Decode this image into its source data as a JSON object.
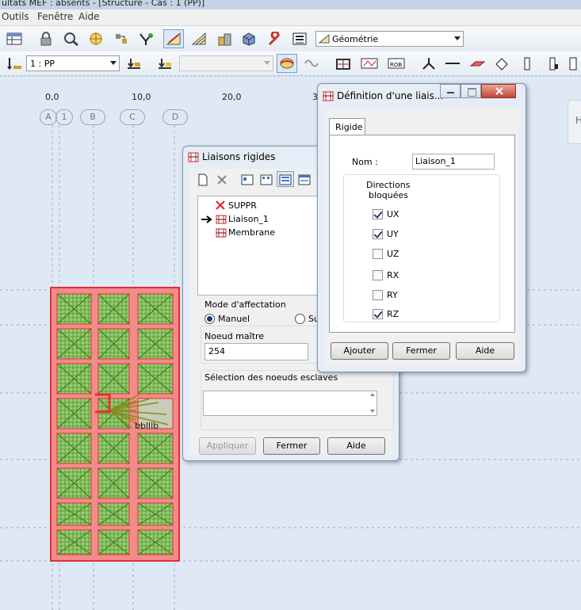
{
  "app": {
    "title_fragment": "ultats MEF : absents - [Structure - Cas : 1 (PP)]"
  },
  "menu": [
    "Outils",
    "Fenêtre",
    "Aide"
  ],
  "toolbar": {
    "view_selector": "Géométrie",
    "load_case_selector": "1 : PP",
    "empty_selector": ""
  },
  "ruler": {
    "ticks": [
      "0,0",
      "10,0",
      "20,0",
      "3"
    ],
    "axes": [
      "A",
      "1",
      "B",
      "C",
      "D"
    ],
    "edge_button": "H"
  },
  "canvas": {
    "node_label": "bblllb"
  },
  "liaisons_dialog": {
    "title": "Liaisons rigides",
    "list_items": [
      "SUPPR",
      "Liaison_1",
      "Membrane"
    ],
    "mode_label": "Mode d'affectation",
    "mode_manual": "Manuel",
    "mode_other": "Su",
    "master_node_label": "Noeud maître",
    "master_node_value": "254",
    "slave_nodes_label": "Sélection des noeuds esclaves",
    "slave_nodes_value": "",
    "btn_apply": "Appliquer",
    "btn_close": "Fermer",
    "btn_help": "Aide"
  },
  "definition_dialog": {
    "title": "Définition d'une liais...",
    "tab": "Rigide",
    "name_label": "Nom :",
    "name_value": "Liaison_1",
    "directions_label_1": "Directions",
    "directions_label_2": "bloquées",
    "directions": [
      {
        "label": "UX",
        "checked": true
      },
      {
        "label": "UY",
        "checked": true
      },
      {
        "label": "UZ",
        "checked": false
      },
      {
        "label": "RX",
        "checked": false
      },
      {
        "label": "RY",
        "checked": false
      },
      {
        "label": "RZ",
        "checked": true
      }
    ],
    "btn_add": "Ajouter",
    "btn_close": "Fermer",
    "btn_help": "Aide"
  },
  "colors": {
    "slab_fill": "#f38b8b",
    "slab_border": "#e03030",
    "mesh_green": "#3f9a1a",
    "selected_cell": "#c9cdb7"
  }
}
